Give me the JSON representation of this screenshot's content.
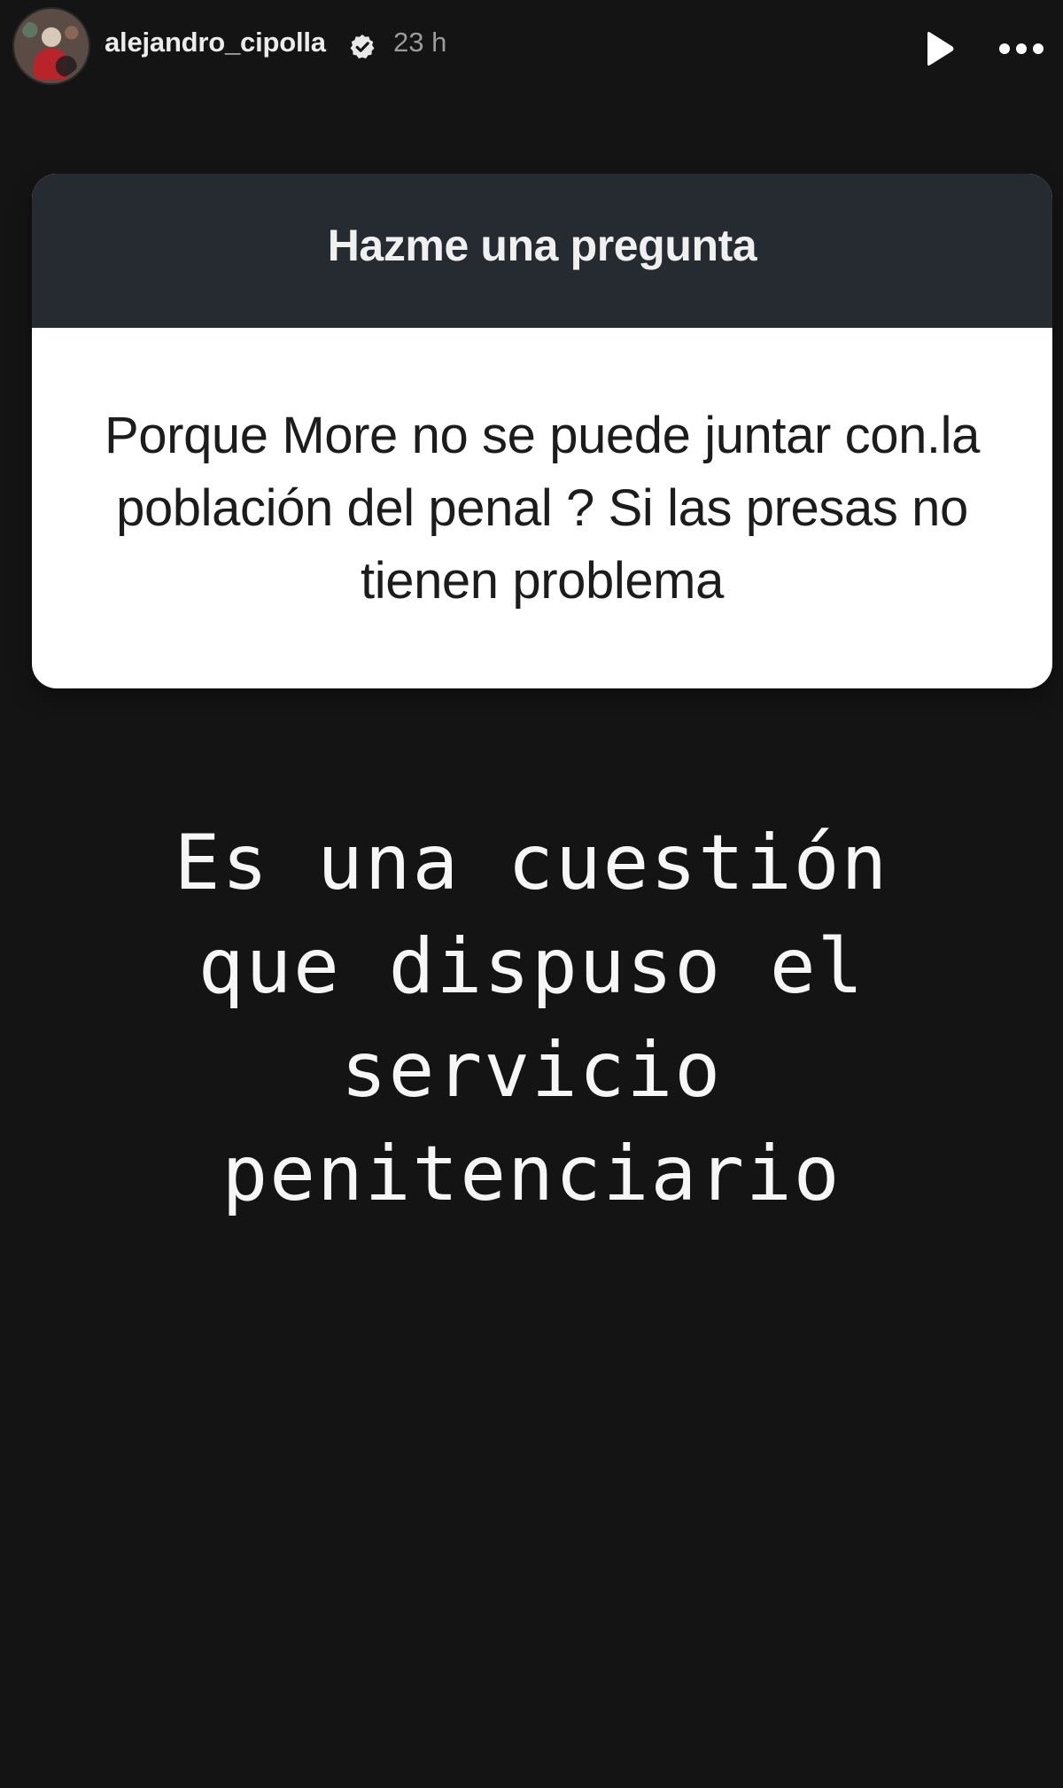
{
  "story_header": {
    "username": "alejandro_cipolla",
    "time_ago": "23 h",
    "icons": {
      "verified": "verified-icon",
      "play": "play-icon",
      "more": "more-options-icon"
    }
  },
  "question_sticker": {
    "title": "Hazme una pregunta",
    "question": "Porque More no se puede juntar con.la población del penal ? Si las presas no tienen problema"
  },
  "answer": {
    "text": "Es una cuestión que dispuso el servicio penitenciario"
  },
  "colors": {
    "background": "#141414",
    "sticker_header": "#262a31",
    "sticker_body": "#ffffff",
    "primary_text": "#ffffff",
    "secondary_text": "#9b9b9b"
  }
}
